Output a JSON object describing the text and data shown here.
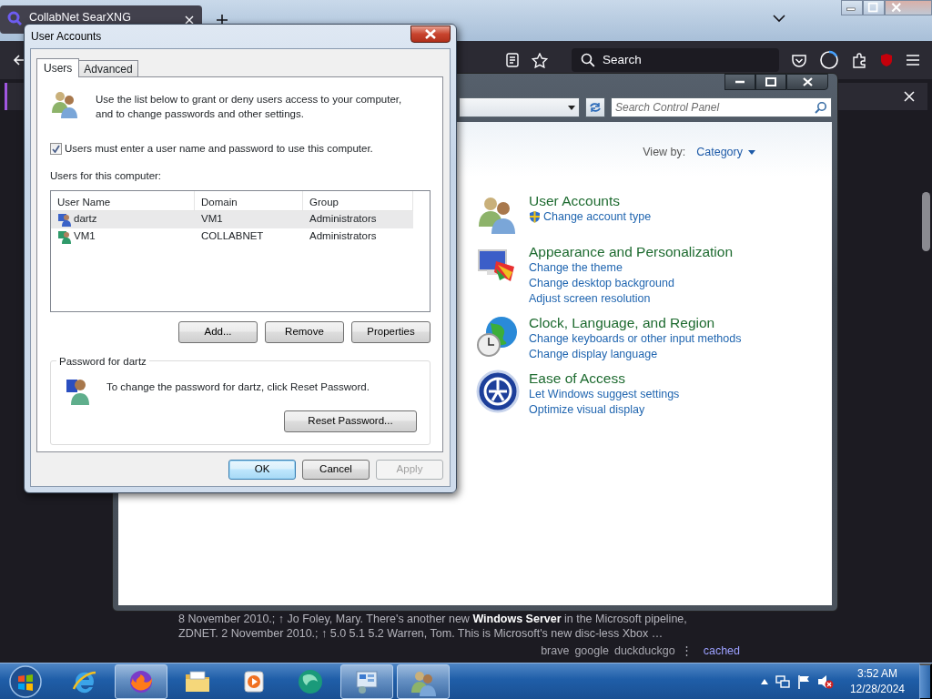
{
  "browser": {
    "tab": {
      "title": "CollabNet SearXNG",
      "selected": true
    },
    "search_placeholder": "Search",
    "snippet": [
      "8 November 2010.; ↑ Jo Foley, Mary. There's another new **Windows Server** in the Microsoft pipeline,",
      "ZDNET. 2 November 2010.; ↑ 5.0 5.1 5.2 Warren, Tom. This is Microsoft's new disc-less Xbox …"
    ],
    "engines": [
      "brave",
      "google",
      "duckduckgo"
    ],
    "more": "⋮",
    "cached": "cached"
  },
  "control_panel": {
    "search_placeholder": "Search Control Panel",
    "view_by_label": "View by:",
    "view_by_value": "Category",
    "categories": [
      {
        "kind": "users",
        "title": "User Accounts",
        "links": [
          {
            "text": "Change account type",
            "shield": true
          }
        ]
      },
      {
        "kind": "appearance",
        "title": "Appearance and Personalization",
        "links": [
          {
            "text": "Change the theme",
            "shield": false
          },
          {
            "text": "Change desktop background",
            "shield": false
          },
          {
            "text": "Adjust screen resolution",
            "shield": false
          }
        ]
      },
      {
        "kind": "clock",
        "title": "Clock, Language, and Region",
        "links": [
          {
            "text": "Change keyboards or other input methods",
            "shield": false
          },
          {
            "text": "Change display language",
            "shield": false
          }
        ]
      },
      {
        "kind": "access",
        "title": "Ease of Access",
        "links": [
          {
            "text": "Let Windows suggest settings",
            "shield": false
          },
          {
            "text": "Optimize visual display",
            "shield": false
          }
        ]
      }
    ]
  },
  "dialog": {
    "title": "User Accounts",
    "tabs": [
      {
        "label": "Users",
        "selected": true
      },
      {
        "label": "Advanced",
        "selected": false
      }
    ],
    "intro": "Use the list below to grant or deny users access to your computer, and to change passwords and other settings.",
    "require_password": {
      "label": "Users must enter a user name and password to use this computer.",
      "checked": true
    },
    "list_label": "Users for this computer:",
    "columns": [
      "User Name",
      "Domain",
      "Group"
    ],
    "users": [
      {
        "kind": "local",
        "name": "dartz",
        "domain": "VM1",
        "group": "Administrators",
        "selected": true
      },
      {
        "kind": "domain",
        "name": "VM1",
        "domain": "COLLABNET",
        "group": "Administrators",
        "selected": false
      }
    ],
    "list_buttons": [
      "Add...",
      "Remove",
      "Properties"
    ],
    "password_group": {
      "title": "Password for dartz",
      "text": "To change the password for dartz, click Reset Password.",
      "button": "Reset Password..."
    },
    "footer_buttons": [
      {
        "label": "OK",
        "default": true,
        "disabled": false
      },
      {
        "label": "Cancel",
        "default": false,
        "disabled": false
      },
      {
        "label": "Apply",
        "default": false,
        "disabled": true
      }
    ]
  },
  "taskbar": {
    "apps": [
      {
        "kind": "ie",
        "running": false
      },
      {
        "kind": "firefox",
        "running": true
      },
      {
        "kind": "explorer",
        "running": false
      },
      {
        "kind": "media",
        "running": false
      },
      {
        "kind": "green",
        "running": false
      },
      {
        "kind": "control-panel",
        "running": true
      },
      {
        "kind": "user-accounts",
        "running": true
      }
    ],
    "time": "3:52 AM",
    "date": "12/28/2024"
  }
}
